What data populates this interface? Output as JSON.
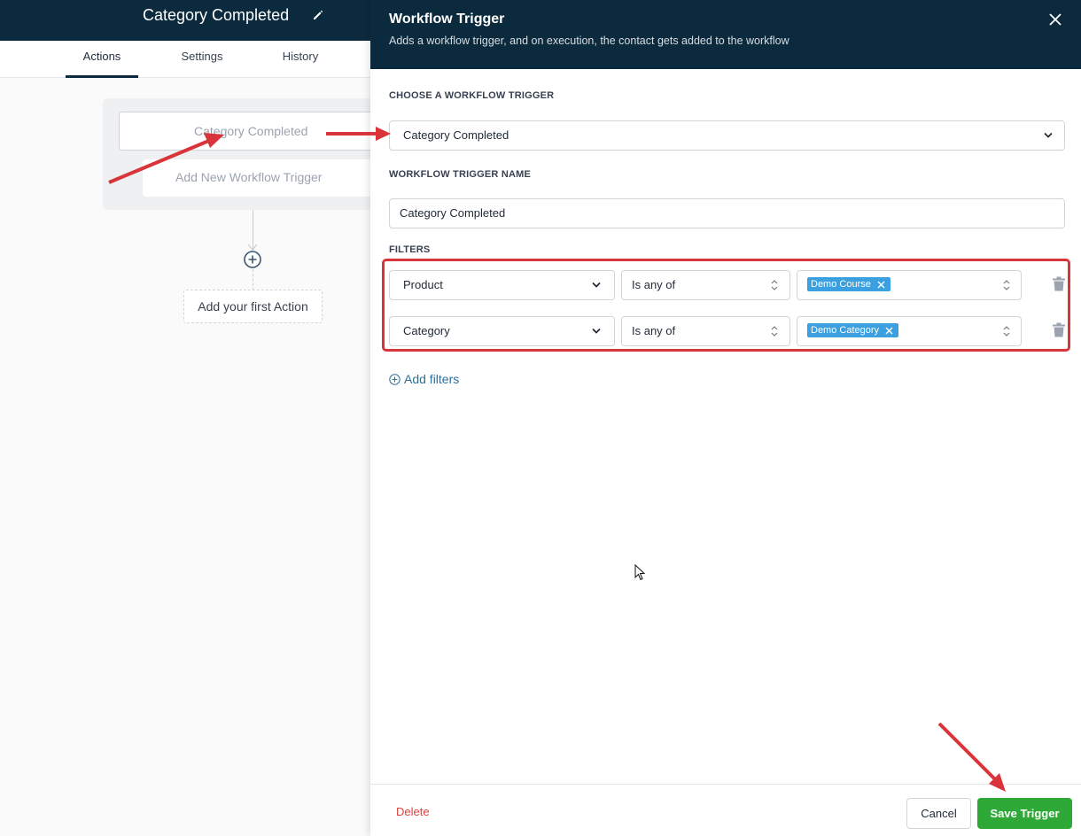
{
  "workflow": {
    "title": "Category Completed",
    "tabs": [
      {
        "label": "Actions",
        "active": true
      },
      {
        "label": "Settings",
        "active": false
      },
      {
        "label": "History",
        "active": false
      }
    ],
    "trigger_card": "Category Completed",
    "add_trigger": "Add New Workflow Trigger",
    "first_action": "Add your first Action"
  },
  "drawer": {
    "title": "Workflow Trigger",
    "subtitle": "Adds a workflow trigger, and on execution, the contact gets added to the workflow",
    "choose_label": "CHOOSE A WORKFLOW TRIGGER",
    "trigger_value": "Category Completed",
    "name_label": "WORKFLOW TRIGGER NAME",
    "name_value": "Category Completed",
    "filters_label": "FILTERS",
    "filters": [
      {
        "field": "Product",
        "operator": "Is any of",
        "tag": "Demo Course"
      },
      {
        "field": "Category",
        "operator": "Is any of",
        "tag": "Demo Category"
      }
    ],
    "add_filters": "Add filters",
    "footer": {
      "delete": "Delete",
      "cancel": "Cancel",
      "save": "Save Trigger"
    }
  },
  "colors": {
    "header_bg": "#0c2a3d",
    "save_button": "#2ea836",
    "tag": "#3aa0e0",
    "delete_text": "#e0413c",
    "annotation": "#d9343a"
  },
  "icons": [
    "edit-icon",
    "plus-circle-icon",
    "close-icon",
    "chevron-down-icon",
    "sort-icon",
    "tag-remove-icon",
    "trash-icon",
    "add-circle-icon",
    "cursor-icon"
  ]
}
